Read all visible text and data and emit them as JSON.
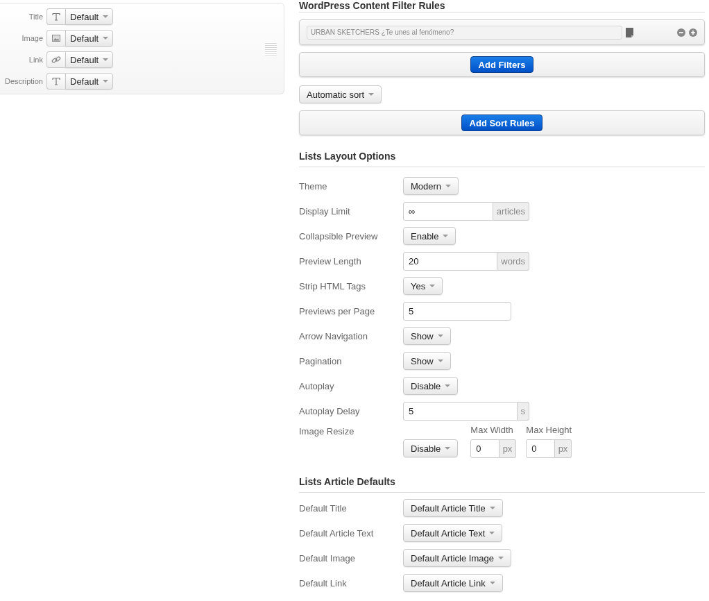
{
  "mapping_panel": {
    "fields": [
      {
        "label": "Title",
        "value": "Default"
      },
      {
        "label": "Image",
        "value": "Default"
      },
      {
        "label": "Link",
        "value": "Default"
      },
      {
        "label": "Description",
        "value": "Default"
      }
    ]
  },
  "filter_section": {
    "heading": "WordPress Content Filter Rules",
    "filters": [
      {
        "placeholder": "URBAN SKETCHERS ¿Te unes al fenómeno?"
      }
    ],
    "add_filters_button": "Add Filters",
    "sort_dropdown": "Automatic sort",
    "add_sort_button": "Add Sort Rules"
  },
  "layout_section": {
    "heading": "Lists Layout Options",
    "rows": [
      {
        "kind": "dropdown",
        "label": "Theme",
        "value": "Modern"
      },
      {
        "kind": "input",
        "label": "Display Limit",
        "value": "∞",
        "addon": "articles"
      },
      {
        "kind": "dropdown",
        "label": "Collapsible Preview",
        "value": "Enable"
      },
      {
        "kind": "input",
        "label": "Preview Length",
        "value": "20",
        "addon": "words"
      },
      {
        "kind": "dropdown",
        "label": "Strip HTML Tags",
        "value": "Yes"
      },
      {
        "kind": "input",
        "label": "Previews per Page",
        "value": "5"
      },
      {
        "kind": "dropdown",
        "label": "Arrow Navigation",
        "value": "Show"
      },
      {
        "kind": "dropdown",
        "label": "Pagination",
        "value": "Show"
      },
      {
        "kind": "dropdown",
        "label": "Autoplay",
        "value": "Disable"
      },
      {
        "kind": "input",
        "label": "Autoplay Delay",
        "value": "5",
        "addon": "s"
      },
      {
        "kind": "resize",
        "label": "Image Resize",
        "value": "Disable",
        "fields": [
          {
            "label": "Max Width",
            "value": "0",
            "addon": "px"
          },
          {
            "label": "Max Height",
            "value": "0",
            "addon": "px"
          }
        ]
      }
    ]
  },
  "defaults_section": {
    "heading": "Lists Article Defaults",
    "rows": [
      {
        "kind": "dropdown",
        "label": "Default Title",
        "value": "Default Article Title"
      },
      {
        "kind": "dropdown",
        "label": "Default Article Text",
        "value": "Default Article Text"
      },
      {
        "kind": "dropdown",
        "label": "Default Image",
        "value": "Default Article Image"
      },
      {
        "kind": "dropdown",
        "label": "Default Link",
        "value": "Default Article Link"
      }
    ]
  }
}
